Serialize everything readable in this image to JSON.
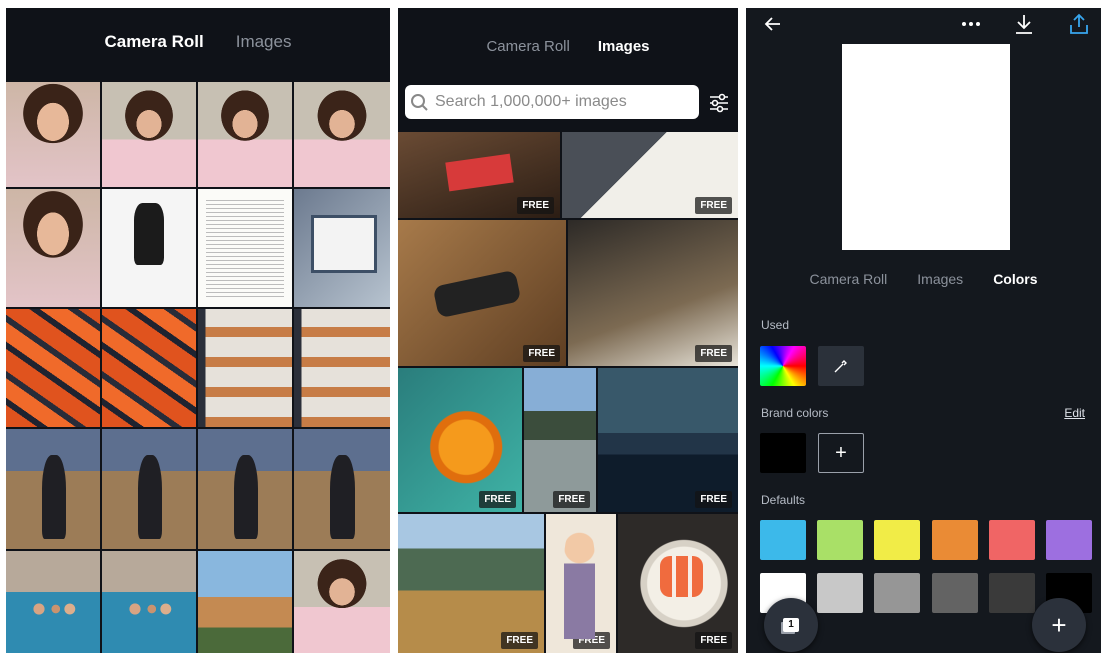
{
  "panel1": {
    "tabs": [
      {
        "label": "Camera Roll",
        "active": true
      },
      {
        "label": "Images",
        "active": false
      }
    ]
  },
  "panel2": {
    "tabs": [
      {
        "label": "Camera Roll",
        "active": false
      },
      {
        "label": "Images",
        "active": true
      }
    ],
    "search": {
      "placeholder": "Search 1,000,000+ images"
    },
    "free_badge": "FREE"
  },
  "panel3": {
    "tabs": [
      {
        "label": "Camera Roll",
        "active": false
      },
      {
        "label": "Images",
        "active": false
      },
      {
        "label": "Colors",
        "active": true
      }
    ],
    "used_label": "Used",
    "brand_label": "Brand colors",
    "edit_label": "Edit",
    "defaults_label": "Defaults",
    "brand_colors": [
      "#000000"
    ],
    "default_colors": [
      "#3cb9ea",
      "#a9e067",
      "#f1ec47",
      "#ea8b35",
      "#f06565",
      "#9d6fe0",
      "#ffffff",
      "#c8c8c8",
      "#969696",
      "#636363",
      "#3a3a3a",
      "#000000"
    ],
    "pages_count": "1"
  }
}
